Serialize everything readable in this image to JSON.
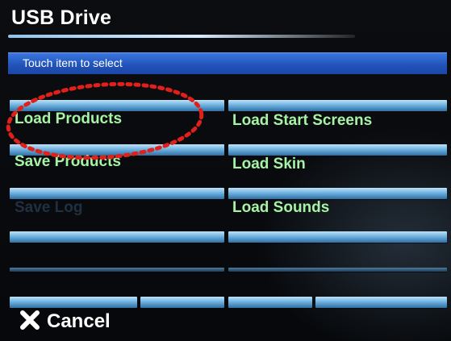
{
  "header": {
    "title": "USB Drive",
    "instruction": "Touch item to select"
  },
  "menu": {
    "left": [
      {
        "label": "Load Products",
        "enabled": true
      },
      {
        "label": "Save Products",
        "enabled": true
      },
      {
        "label": "Save Log",
        "enabled": false
      }
    ],
    "right": [
      {
        "label": "Load Start Screens",
        "enabled": true
      },
      {
        "label": "Load Skin",
        "enabled": true
      },
      {
        "label": "Load Sounds",
        "enabled": true
      }
    ]
  },
  "footer": {
    "cancel_label": "Cancel"
  },
  "colors": {
    "label_green": "#a6f3a5",
    "instruction_bar": "#2152b8",
    "annotation_red": "#e0201b"
  }
}
